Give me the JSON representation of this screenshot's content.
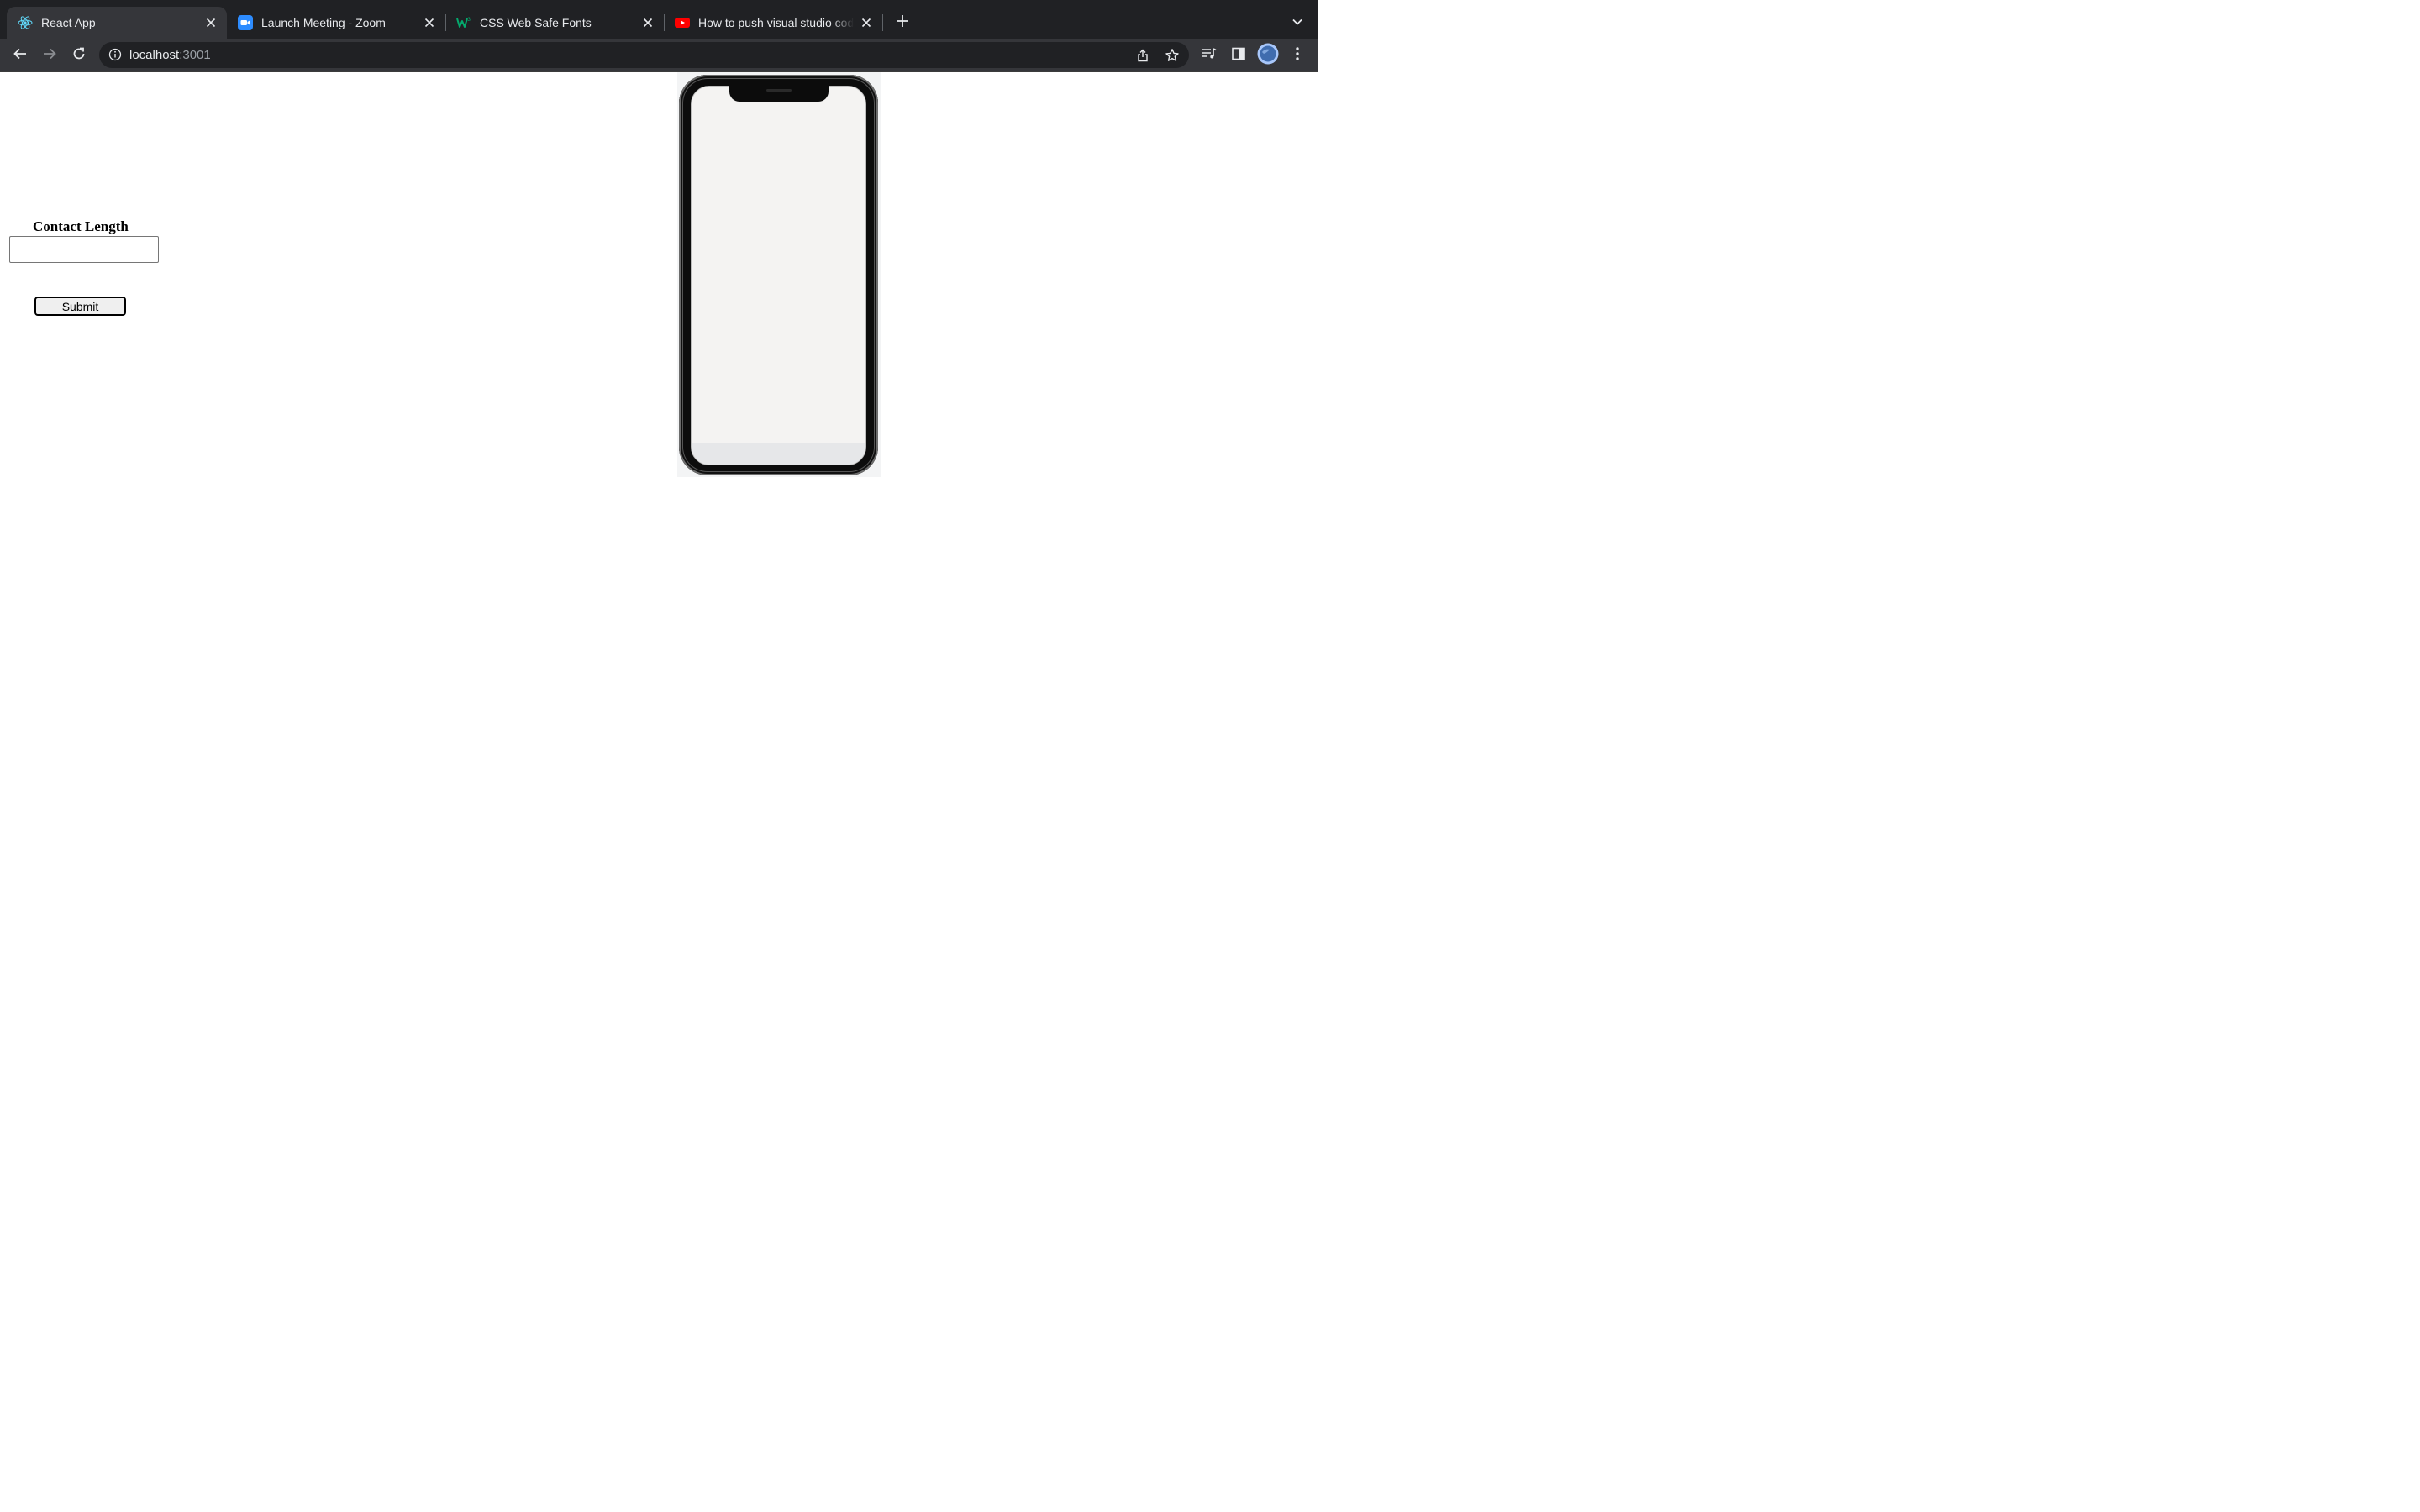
{
  "tabs": [
    {
      "title": "React App",
      "favicon": "react-icon",
      "active": true
    },
    {
      "title": "Launch Meeting - Zoom",
      "favicon": "zoom-icon",
      "active": false
    },
    {
      "title": "CSS Web Safe Fonts",
      "favicon": "w3schools-icon",
      "active": false
    },
    {
      "title": "How to push visual studio code",
      "favicon": "youtube-icon",
      "active": false
    }
  ],
  "omnibox": {
    "host": "localhost",
    "port": ":3001"
  },
  "form": {
    "label": "Contact Length",
    "input_value": "",
    "submit_label": "Submit"
  },
  "colors": {
    "tabstrip": "#202124",
    "toolbar": "#35363a",
    "omnibox": "#202124",
    "text_light": "#e8eaed"
  }
}
